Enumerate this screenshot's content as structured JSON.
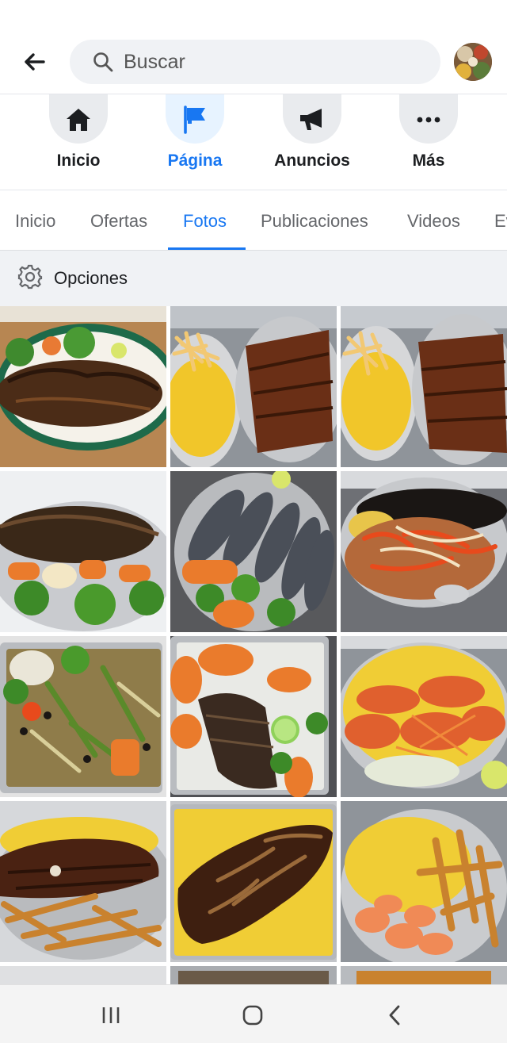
{
  "search": {
    "placeholder": "Buscar"
  },
  "actions": [
    {
      "label": "Inicio",
      "icon": "home-icon"
    },
    {
      "label": "Página",
      "icon": "flag-icon",
      "active": true
    },
    {
      "label": "Anuncios",
      "icon": "megaphone-icon"
    },
    {
      "label": "Más",
      "icon": "more-icon"
    }
  ],
  "tabs": [
    {
      "label": "Inicio"
    },
    {
      "label": "Ofertas"
    },
    {
      "label": "Fotos",
      "active": true
    },
    {
      "label": "Publicaciones"
    },
    {
      "label": "Videos"
    },
    {
      "label": "Ev"
    }
  ],
  "options": {
    "label": "Opciones",
    "icon": "gear-icon"
  },
  "photos": [
    {
      "name": "whole-grilled-fish"
    },
    {
      "name": "ribs-with-fries-and-rice"
    },
    {
      "name": "ribs-with-fries-and-rice"
    },
    {
      "name": "fried-fish-with-vegetables"
    },
    {
      "name": "grilled-sardines"
    },
    {
      "name": "beef-with-beans-and-rice"
    },
    {
      "name": "stir-fry-tray"
    },
    {
      "name": "grilled-fish-fillet-tray"
    },
    {
      "name": "shrimp-with-rice"
    },
    {
      "name": "steak-with-fries-and-rice"
    },
    {
      "name": "steak-with-onions-and-rice"
    },
    {
      "name": "shrimp-with-fries-and-rice"
    }
  ],
  "colors": {
    "accent": "#1877f2",
    "muted": "#65676b",
    "background": "#f0f2f5"
  }
}
